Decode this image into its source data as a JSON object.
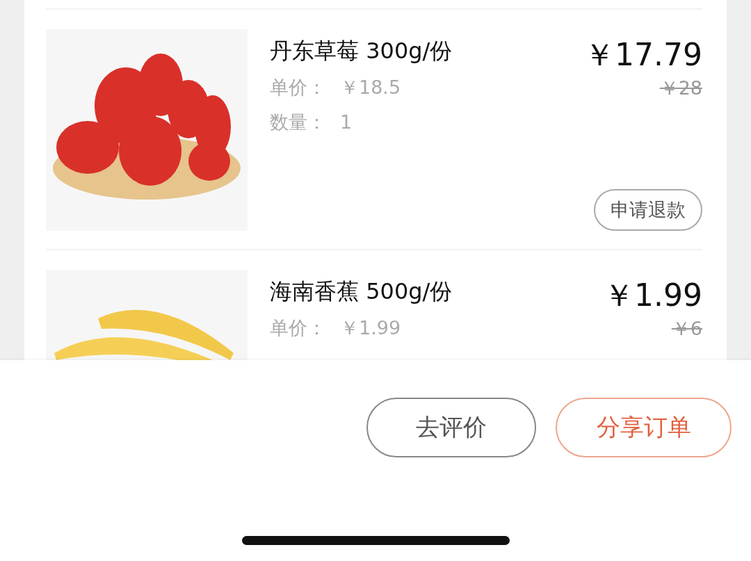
{
  "items": [
    {
      "name": "丹东草莓 300g/份",
      "unit_price_label": "单价：",
      "unit_price": "￥18.5",
      "quantity_label": "数量：",
      "quantity": "1",
      "price": "￥17.79",
      "original_price": "￥28",
      "kind": "strawberry",
      "refund_button": "申请退款"
    },
    {
      "name": "海南香蕉 500g/份",
      "unit_price_label": "单价：",
      "unit_price": "￥1.99",
      "price": "￥1.99",
      "original_price": "￥6",
      "kind": "banana"
    }
  ],
  "bottom_bar": {
    "buttons": [
      {
        "label": "去评价",
        "kind": "plain"
      },
      {
        "label": "分享订单",
        "kind": "accent"
      }
    ]
  }
}
